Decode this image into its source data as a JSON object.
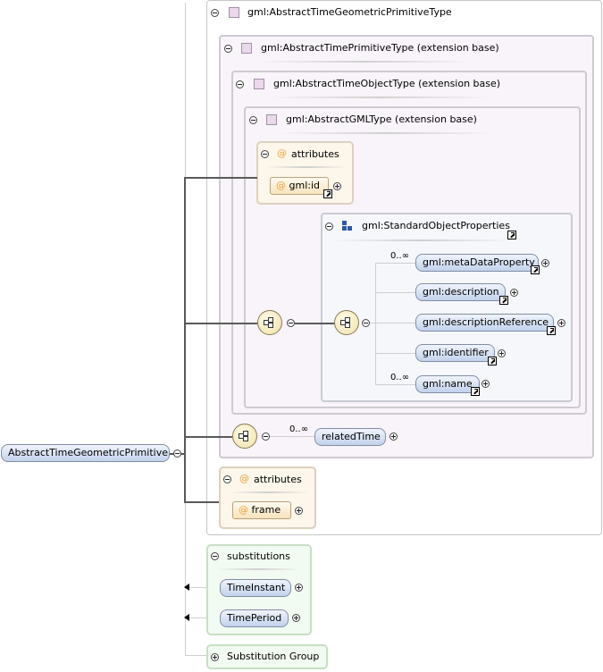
{
  "root": {
    "label": "AbstractTimeGeometricPrimitive"
  },
  "types": {
    "t1": "gml:AbstractTimeGeometricPrimitiveType",
    "t2": "gml:AbstractTimePrimitiveType (extension base)",
    "t3": "gml:AbstractTimeObjectType (extension base)",
    "t4": "gml:AbstractGMLType (extension base)"
  },
  "attributes_inner": {
    "title": "attributes",
    "items": [
      "gml:id"
    ]
  },
  "group": {
    "title": "gml:StandardObjectProperties",
    "elements": [
      {
        "label": "gml:metaDataProperty",
        "card": "0..∞"
      },
      {
        "label": "gml:description",
        "card": ""
      },
      {
        "label": "gml:descriptionReference",
        "card": ""
      },
      {
        "label": "gml:identifier",
        "card": ""
      },
      {
        "label": "gml:name",
        "card": "0..∞"
      }
    ]
  },
  "related": {
    "label": "relatedTime",
    "card": "0..∞"
  },
  "attributes_outer": {
    "title": "attributes",
    "items": [
      "frame"
    ]
  },
  "substitutions": {
    "title": "substitutions",
    "items": [
      "TimeInstant",
      "TimePeriod"
    ]
  },
  "substitution_group": {
    "label": "Substitution Group"
  },
  "colors": {
    "element": "#c2d2ec",
    "attribute": "#f8e3bd",
    "type_box": "#f8f4f9",
    "substitution": "#f2fbf1"
  }
}
